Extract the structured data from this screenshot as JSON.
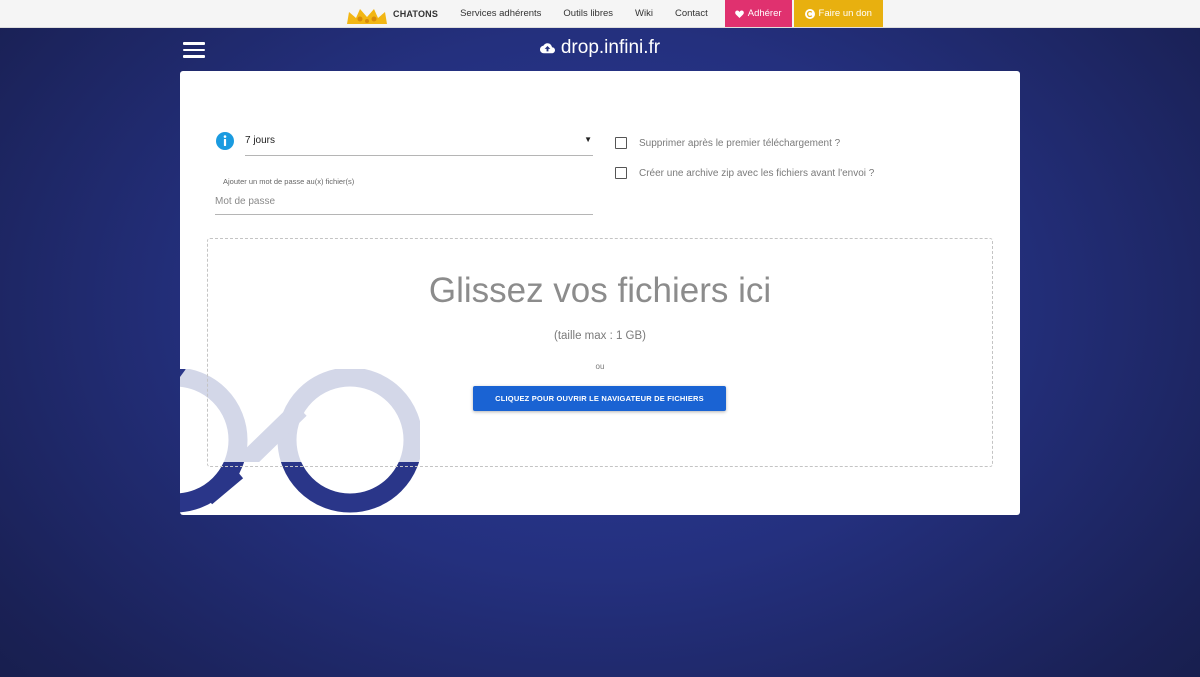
{
  "topbar": {
    "brand": "CHATONS",
    "nav": [
      "Services adhérents",
      "Outils libres",
      "Wiki",
      "Contact"
    ],
    "adherer_label": "Adhérer",
    "don_label": "Faire un don",
    "colors": {
      "adherer": "#e0316f",
      "don": "#e8b00f"
    }
  },
  "header": {
    "site_title": "drop.infini.fr"
  },
  "form": {
    "expiry_selected": "7 jours",
    "password_label": "Ajouter un mot de passe au(x) fichier(s)",
    "password_placeholder": "Mot de passe",
    "delete_after_download_label": "Supprimer après le premier téléchargement ?",
    "delete_after_download_checked": false,
    "zip_archive_label": "Créer une archive zip avec les fichiers avant l'envoi ?",
    "zip_archive_checked": false
  },
  "dropzone": {
    "title": "Glissez vos fichiers ici",
    "max_size": "(taille max : 1 GB)",
    "or": "ou",
    "browse_button": "CLIQUEZ POUR OUVRIR LE NAVIGATEUR DE FICHIERS"
  },
  "icons": {
    "info": "info-icon",
    "cloud": "cloud-upload-icon",
    "menu": "hamburger-menu-icon",
    "heart": "heart-icon",
    "coin": "coin-icon",
    "crown": "crown-logo-icon"
  },
  "colors": {
    "background": "#24307e",
    "primary_button": "#1a63d3",
    "info": "#1a9be0"
  }
}
